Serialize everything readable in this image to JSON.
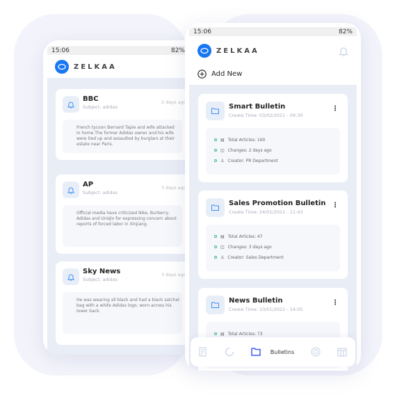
{
  "brand": "ZELKAA",
  "back_phone": {
    "status": {
      "time": "15:06",
      "battery": "82%"
    },
    "notifications": [
      {
        "source": "BBC",
        "subject": "Subject: adidas",
        "age": "2 days ago",
        "text": "French tycoon Bernard Tapie and wife attacked in home The former Adidas owner and his wife were tied up and assaulted by burglars at their estate near Paris."
      },
      {
        "source": "AP",
        "subject": "Subject: adidas",
        "age": "3 days ago",
        "text": "Official media have criticized Nike, Burberry, Adidas and Uniqlo for expressing concern about reports of forced labor in Xinjiang."
      },
      {
        "source": "Sky News",
        "subject": "Subject: adidas",
        "age": "3 days ago",
        "text": "He was wearing all black and had a black satchel bag with a white Adidas logo, worn across his lower back."
      }
    ]
  },
  "front_phone": {
    "status": {
      "time": "15:06",
      "battery": "82%"
    },
    "add_new": "Add New",
    "bulletins": [
      {
        "name": "Smart Bulletin",
        "created": "Create Time: 03/02/2021 - 09:30",
        "articles": "Total Articles: 160",
        "changes": "Changes: 2 days ago",
        "creator": "Creator: PR Department"
      },
      {
        "name": "Sales Promotion Bulletin",
        "created": "Create Time: 24/01/2021 - 11:43",
        "articles": "Total Articles: 47",
        "changes": "Changes: 3 days ago",
        "creator": "Creator: Sales Department"
      },
      {
        "name": "News Bulletin",
        "created": "Create Time: 10/01/2021 - 14:05",
        "articles": "Total Articles: 73"
      }
    ],
    "nav": {
      "active_label": "Bulletins",
      "icons": [
        "document-icon",
        "loading-icon",
        "folder-icon",
        "target-icon",
        "table-icon"
      ]
    }
  },
  "colors": {
    "accent": "#1877f2",
    "active_nav": "#3b5bfd",
    "dot": "#3cb982",
    "content_bg": "#e9edf6"
  }
}
